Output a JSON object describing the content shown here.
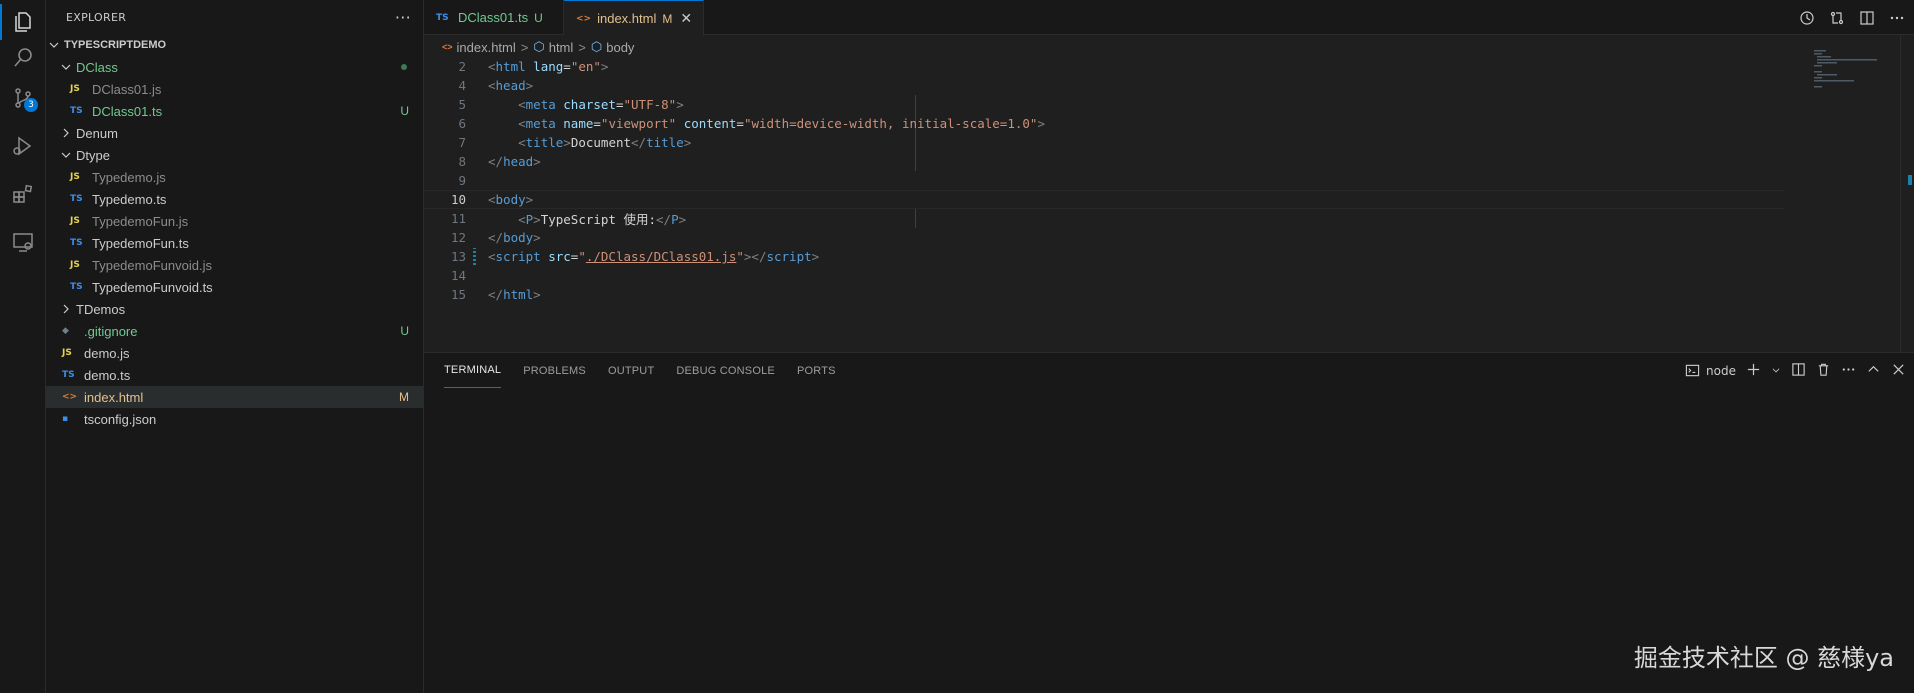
{
  "activity": {
    "scm_badge": "3"
  },
  "sidebar": {
    "title": "EXPLORER",
    "more": "···",
    "root": "TYPESCRIPTDEMO",
    "items": [
      {
        "label": "DClass",
        "icon": "TS"
      },
      {
        "label": "DClass01.js",
        "icon": "JS"
      },
      {
        "label": "DClass01.ts",
        "icon": "TS",
        "status": "U"
      },
      {
        "label": "Denum"
      },
      {
        "label": "Dtype"
      },
      {
        "label": "Typedemo.js",
        "icon": "JS"
      },
      {
        "label": "Typedemo.ts",
        "icon": "TS"
      },
      {
        "label": "TypedemoFun.js",
        "icon": "JS"
      },
      {
        "label": "TypedemoFun.ts",
        "icon": "TS"
      },
      {
        "label": "TypedemoFunvoid.js",
        "icon": "JS"
      },
      {
        "label": "TypedemoFunvoid.ts",
        "icon": "TS"
      },
      {
        "label": "TDemos"
      },
      {
        "label": ".gitignore",
        "icon": "◆",
        "status": "U"
      },
      {
        "label": "demo.js",
        "icon": "JS"
      },
      {
        "label": "demo.ts",
        "icon": "TS"
      },
      {
        "label": "index.html",
        "icon": "<>",
        "status": "M"
      },
      {
        "label": "tsconfig.json",
        "icon": "▪"
      }
    ]
  },
  "tabs": [
    {
      "icon": "TS",
      "label": "DClass01.ts",
      "state": "U"
    },
    {
      "icon": "<>",
      "label": "index.html",
      "state": "M",
      "close": "✕"
    }
  ],
  "breadcrumb": {
    "file": "index.html",
    "sep1": ">",
    "html": "html",
    "sep2": ">",
    "body": "body"
  },
  "code": {
    "line_numbers": [
      "2",
      "4",
      "5",
      "6",
      "7",
      "8",
      "9",
      "10",
      "11",
      "12",
      "13",
      "14",
      "15"
    ]
  },
  "panel": {
    "tabs": [
      "TERMINAL",
      "PROBLEMS",
      "OUTPUT",
      "DEBUG CONSOLE",
      "PORTS"
    ],
    "terminal_name": "node"
  },
  "watermark": "掘金技术社区 @ 慈様ya",
  "colors": {
    "accent": "#0078d4",
    "untracked": "#73c991",
    "modified": "#e2c08d"
  }
}
